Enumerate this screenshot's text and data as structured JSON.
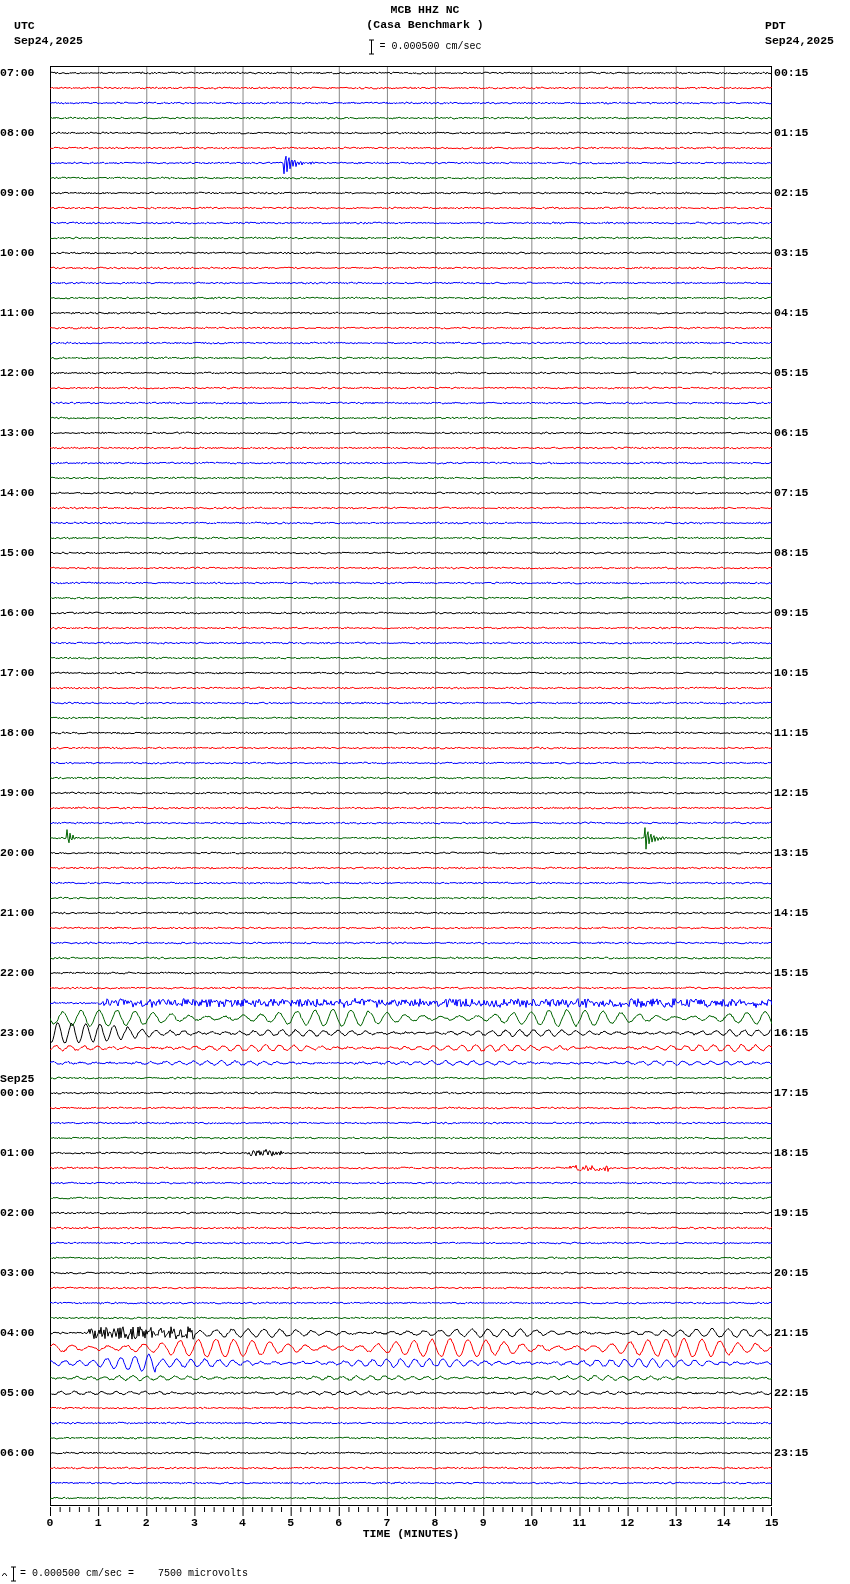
{
  "header": {
    "left_zone": "UTC",
    "left_date": "Sep24,2025",
    "title": "MCB HHZ NC",
    "subtitle": "(Casa Benchmark )",
    "scale": "= 0.000500 cm/sec",
    "right_zone": "PDT",
    "right_date": "Sep24,2025"
  },
  "trace_colors": [
    {
      "color": "#000000"
    },
    {
      "color": "#ff0000"
    },
    {
      "color": "#0000ff"
    },
    {
      "color": "#006400"
    }
  ],
  "hours": [
    {
      "utc": "07:00",
      "local": "00:15"
    },
    {
      "utc": "08:00",
      "local": "01:15"
    },
    {
      "utc": "09:00",
      "local": "02:15"
    },
    {
      "utc": "10:00",
      "local": "03:15"
    },
    {
      "utc": "11:00",
      "local": "04:15"
    },
    {
      "utc": "12:00",
      "local": "05:15"
    },
    {
      "utc": "13:00",
      "local": "06:15"
    },
    {
      "utc": "14:00",
      "local": "07:15"
    },
    {
      "utc": "15:00",
      "local": "08:15"
    },
    {
      "utc": "16:00",
      "local": "09:15"
    },
    {
      "utc": "17:00",
      "local": "10:15"
    },
    {
      "utc": "18:00",
      "local": "11:15"
    },
    {
      "utc": "19:00",
      "local": "12:15"
    },
    {
      "utc": "20:00",
      "local": "13:15"
    },
    {
      "utc": "21:00",
      "local": "14:15"
    },
    {
      "utc": "22:00",
      "local": "15:15"
    },
    {
      "utc": "23:00",
      "local": "16:15"
    },
    {
      "utc": "00:00",
      "local": "17:15",
      "date": "Sep25"
    },
    {
      "utc": "01:00",
      "local": "18:15"
    },
    {
      "utc": "02:00",
      "local": "19:15"
    },
    {
      "utc": "03:00",
      "local": "20:15"
    },
    {
      "utc": "04:00",
      "local": "21:15"
    },
    {
      "utc": "05:00",
      "local": "22:15"
    },
    {
      "utc": "06:00",
      "local": "23:15"
    }
  ],
  "x_axis": {
    "ticks": [
      "0",
      "1",
      "2",
      "3",
      "4",
      "5",
      "6",
      "7",
      "8",
      "9",
      "10",
      "11",
      "12",
      "13",
      "14",
      "15"
    ],
    "title": "TIME (MINUTES)"
  },
  "footer": {
    "scale": "= 0.000500 cm/sec =    7500 microvolts"
  }
}
